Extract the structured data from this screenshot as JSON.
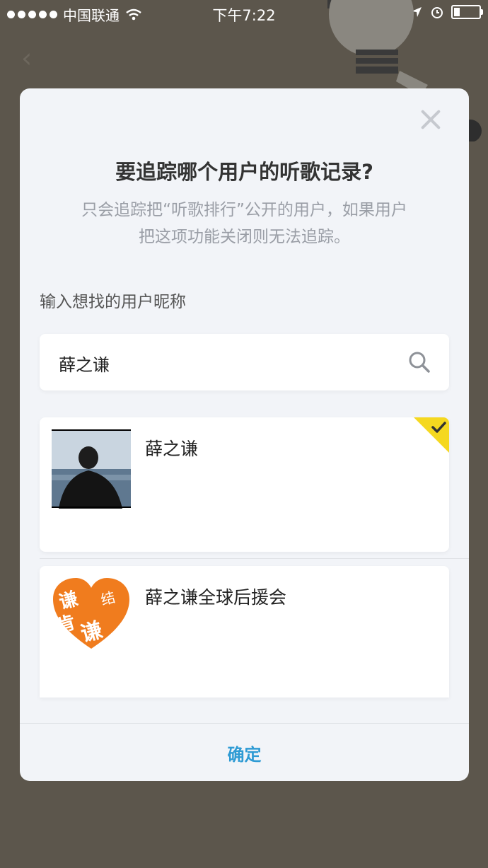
{
  "status_bar": {
    "carrier": "中国联通",
    "time": "下午7:22"
  },
  "modal": {
    "title": "要追踪哪个用户的听歌记录?",
    "subtitle_line1": "只会追踪把“听歌排行”公开的用户，如果用户",
    "subtitle_line2": "把这项功能关闭则无法追踪。",
    "input_label": "输入想找的用户昵称",
    "search_value": "薛之谦",
    "results": [
      {
        "name": "薛之谦",
        "selected": true
      },
      {
        "name": "薛之谦全球后援会",
        "selected": false,
        "logo_text": "谦 结 肯 谦"
      }
    ],
    "confirm_label": "确定"
  },
  "colors": {
    "accent": "#2f9bd4",
    "badge": "#f5d820",
    "logo": "#f07c1e",
    "backdrop": "#5c564c"
  }
}
